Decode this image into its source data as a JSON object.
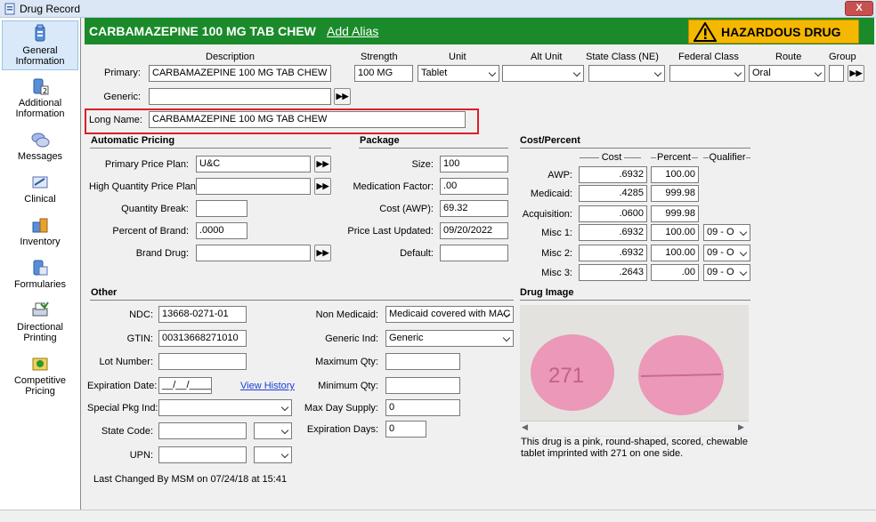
{
  "window": {
    "title": "Drug Record",
    "close_label": "X"
  },
  "sidebar": {
    "items": [
      {
        "line1": "General",
        "line2": "Information",
        "icon": "general-info-icon"
      },
      {
        "line1": "Additional",
        "line2": "Information",
        "icon": "additional-info-icon"
      },
      {
        "line1": "Messages",
        "line2": "",
        "icon": "messages-icon"
      },
      {
        "line1": "Clinical",
        "line2": "",
        "icon": "clinical-icon"
      },
      {
        "line1": "Inventory",
        "line2": "",
        "icon": "inventory-icon"
      },
      {
        "line1": "Formularies",
        "line2": "",
        "icon": "formularies-icon"
      },
      {
        "line1": "Directional",
        "line2": "Printing",
        "icon": "directional-printing-icon"
      },
      {
        "line1": "Competitive",
        "line2": "Pricing",
        "icon": "competitive-pricing-icon"
      }
    ]
  },
  "header": {
    "drug_name": "CARBAMAZEPINE 100 MG TAB CHEW",
    "add_alias": "Add Alias",
    "hazard": "HAZARDOUS DRUG",
    "colors": {
      "header_bg": "#1a8a2a",
      "hazard_bg": "#f5b800"
    }
  },
  "columns": {
    "description": "Description",
    "strength": "Strength",
    "unit": "Unit",
    "alt_unit": "Alt Unit",
    "state_class": "State Class (NE)",
    "federal_class": "Federal Class",
    "route": "Route",
    "group": "Group"
  },
  "primary": {
    "label": "Primary:",
    "description": "CARBAMAZEPINE 100 MG TAB CHEW",
    "strength": "100 MG",
    "unit": "Tablet",
    "alt_unit": "",
    "state_class": "",
    "federal_class": "",
    "route": "Oral",
    "group": ""
  },
  "generic": {
    "label": "Generic:",
    "value": ""
  },
  "long_name": {
    "label": "Long Name:",
    "value": "CARBAMAZEPINE 100 MG TAB CHEW"
  },
  "auto_pricing": {
    "title": "Automatic Pricing",
    "primary_price_plan": {
      "label": "Primary Price Plan:",
      "value": "U&C"
    },
    "high_qty_price_plan": {
      "label": "High Quantity Price Plan:",
      "value": ""
    },
    "quantity_break": {
      "label": "Quantity Break:",
      "value": ""
    },
    "percent_of_brand": {
      "label": "Percent of Brand:",
      "value": ".0000"
    },
    "brand_drug": {
      "label": "Brand Drug:",
      "value": ""
    }
  },
  "package": {
    "title": "Package",
    "size": {
      "label": "Size:",
      "value": "100"
    },
    "medication_factor": {
      "label": "Medication Factor:",
      "value": ".00"
    },
    "cost_awp": {
      "label": "Cost (AWP):",
      "value": "69.32"
    },
    "price_last_updated": {
      "label": "Price Last Updated:",
      "value": "09/20/2022"
    },
    "default": {
      "label": "Default:",
      "value": ""
    }
  },
  "cost_percent": {
    "title": "Cost/Percent",
    "col_cost": "Cost",
    "col_percent": "Percent",
    "col_qualifier": "Qualifier",
    "rows": [
      {
        "label": "AWP:",
        "cost": ".6932",
        "percent": "100.00",
        "qualifier": ""
      },
      {
        "label": "Medicaid:",
        "cost": ".4285",
        "percent": "999.98",
        "qualifier": ""
      },
      {
        "label": "Acquisition:",
        "cost": ".0600",
        "percent": "999.98",
        "qualifier": ""
      },
      {
        "label": "Misc 1:",
        "cost": ".6932",
        "percent": "100.00",
        "qualifier": "09 - O"
      },
      {
        "label": "Misc 2:",
        "cost": ".6932",
        "percent": "100.00",
        "qualifier": "09 - O"
      },
      {
        "label": "Misc 3:",
        "cost": ".2643",
        "percent": ".00",
        "qualifier": "09 - O"
      }
    ]
  },
  "other": {
    "title": "Other",
    "ndc": {
      "label": "NDC:",
      "value": "13668-0271-01"
    },
    "gtin": {
      "label": "GTIN:",
      "value": "00313668271010"
    },
    "lot_number": {
      "label": "Lot Number:",
      "value": ""
    },
    "expiration_date": {
      "label": "Expiration Date:",
      "value": "__/__/____",
      "view_history": "View History"
    },
    "special_pkg_ind": {
      "label": "Special Pkg Ind:",
      "value": ""
    },
    "state_code": {
      "label": "State Code:",
      "value": ""
    },
    "upn": {
      "label": "UPN:",
      "value": ""
    },
    "non_medicaid": {
      "label": "Non Medicaid:",
      "value": "Medicaid covered with MAC"
    },
    "generic_ind": {
      "label": "Generic Ind:",
      "value": "Generic"
    },
    "maximum_qty": {
      "label": "Maximum Qty:",
      "value": ""
    },
    "minimum_qty": {
      "label": "Minimum Qty:",
      "value": ""
    },
    "max_day_supply": {
      "label": "Max Day Supply:",
      "value": "0"
    },
    "expiration_days": {
      "label": "Expiration Days:",
      "value": "0"
    },
    "last_changed": "Last Changed By MSM on 07/24/18 at 15:41"
  },
  "drug_image": {
    "title": "Drug Image",
    "imprint": "271",
    "caption": "This drug is a pink, round-shaped, scored, chewable tablet imprinted with 271 on one side.",
    "pill_color": "#ec98b8"
  }
}
